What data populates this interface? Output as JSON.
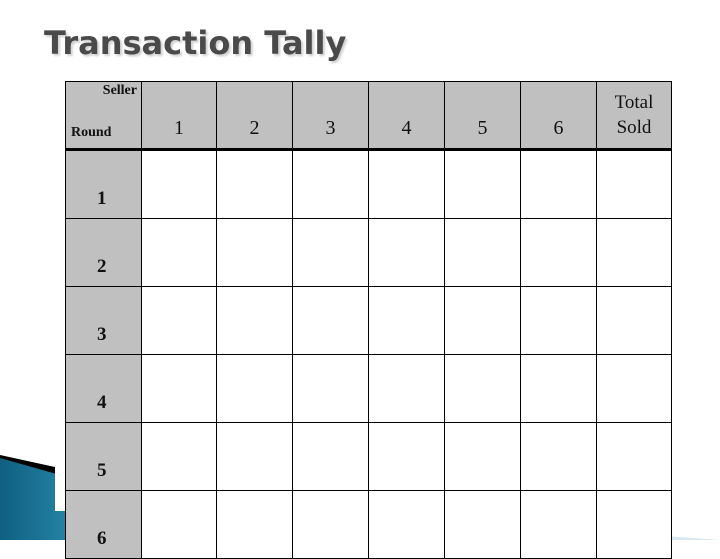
{
  "slide": {
    "title": "Transaction Tally",
    "accent_color": "#1a7fa3"
  },
  "table": {
    "corner": {
      "top_label": "Seller",
      "bottom_label": "Round"
    },
    "columns": [
      "1",
      "2",
      "3",
      "4",
      "5",
      "6"
    ],
    "total_header": "Total Sold",
    "rows": [
      {
        "label": "1",
        "cells": [
          "",
          "",
          "",
          "",
          "",
          "",
          ""
        ]
      },
      {
        "label": "2",
        "cells": [
          "",
          "",
          "",
          "",
          "",
          "",
          ""
        ]
      },
      {
        "label": "3",
        "cells": [
          "",
          "",
          "",
          "",
          "",
          "",
          ""
        ]
      },
      {
        "label": "4",
        "cells": [
          "",
          "",
          "",
          "",
          "",
          "",
          ""
        ]
      },
      {
        "label": "5",
        "cells": [
          "",
          "",
          "",
          "",
          "",
          "",
          ""
        ]
      },
      {
        "label": "6",
        "cells": [
          "",
          "",
          "",
          "",
          "",
          "",
          ""
        ]
      }
    ]
  }
}
